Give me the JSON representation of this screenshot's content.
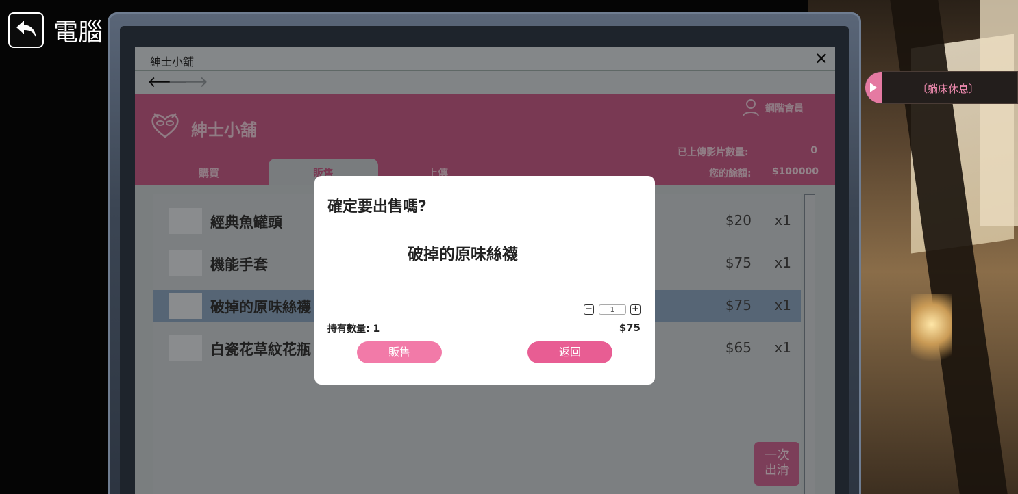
{
  "top": {
    "title": "電腦"
  },
  "side_action": {
    "label": "〔躺床休息〕"
  },
  "window": {
    "title": "紳士小舖",
    "close_glyph": "✕",
    "nav": {
      "back_glyph": "🡐",
      "forward_glyph": "🡒"
    }
  },
  "header": {
    "shop_name": "紳士小舖",
    "member_level": "鋼階會員",
    "stats": [
      {
        "label": "已上傳影片數量:",
        "value": "0"
      },
      {
        "label": "您的餘額:",
        "value": "$100000"
      }
    ],
    "tabs": [
      {
        "label": "購買",
        "active": false
      },
      {
        "label": "販售",
        "active": true
      },
      {
        "label": "上傳",
        "active": false
      }
    ]
  },
  "items": [
    {
      "name": "經典魚罐頭",
      "price": "$20",
      "qty": "x1",
      "selected": false
    },
    {
      "name": "機能手套",
      "price": "$75",
      "qty": "x1",
      "selected": false
    },
    {
      "name": "破掉的原味絲襪",
      "price": "$75",
      "qty": "x1",
      "selected": true
    },
    {
      "name": "白瓷花草紋花瓶",
      "price": "$65",
      "qty": "x1",
      "selected": false
    }
  ],
  "clear_button": {
    "line1": "一次",
    "line2": "出清"
  },
  "dialog": {
    "title": "確定要出售嗎?",
    "item_name": "破掉的原味絲襪",
    "quantity": "1",
    "minus": "−",
    "plus": "+",
    "hold_label": "持有數量: 1",
    "price": "$75",
    "sell_label": "販售",
    "back_label": "返回"
  },
  "colors": {
    "brand_pink": "#c45d87",
    "button_pink": "#f27aa8",
    "selected_row": "#8ca4bd"
  }
}
